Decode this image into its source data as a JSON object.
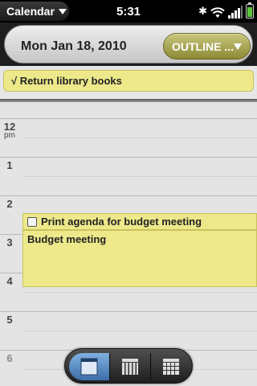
{
  "status_bar": {
    "app_name": "Calendar",
    "time": "5:31",
    "icons": [
      "bluetooth-icon",
      "wifi-icon",
      "signal-icon",
      "battery-icon"
    ],
    "battery_color": "#5ec43a"
  },
  "header": {
    "date": "Mon Jan 18, 2010",
    "view_button_label": "OUTLINE ..."
  },
  "all_day_events": [
    {
      "label": "√ Return library books",
      "color": "#ede98b"
    }
  ],
  "hours": [
    {
      "label": "12",
      "suffix": "pm"
    },
    {
      "label": "1",
      "suffix": ""
    },
    {
      "label": "2",
      "suffix": ""
    },
    {
      "label": "3",
      "suffix": ""
    },
    {
      "label": "4",
      "suffix": ""
    },
    {
      "label": "5",
      "suffix": ""
    },
    {
      "label": "6",
      "suffix": ""
    }
  ],
  "events": [
    {
      "title": "Print agenda for budget meeting",
      "type": "task"
    },
    {
      "title": "Budget meeting",
      "type": "meeting"
    }
  ],
  "view_switcher": {
    "buttons": [
      "day-view-icon",
      "week-view-icon",
      "month-view-icon"
    ],
    "active": "day-view-icon",
    "accent_color": "#3c6ea8"
  }
}
